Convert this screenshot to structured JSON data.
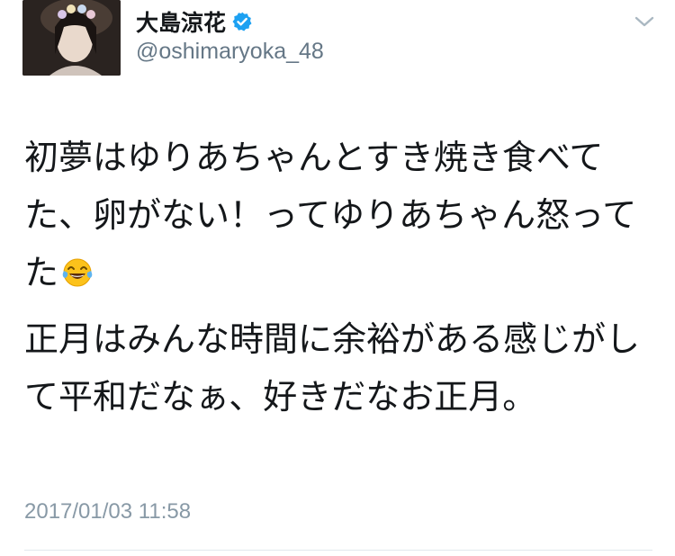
{
  "user": {
    "display_name": "大島涼花",
    "handle": "@oshimaryoka_48",
    "verified": true
  },
  "tweet": {
    "paragraph_1": "初夢はゆりあちゃんとすき焼き食べてた、卵がない！ってゆりあちゃん怒ってた",
    "emoji": "face-with-tears-of-joy-icon",
    "paragraph_2": "正月はみんな時間に余裕がある感じがして平和だなぁ、好きだなお正月。",
    "timestamp": "2017/01/03 11:58"
  },
  "colors": {
    "text": "#14171a",
    "secondary": "#657786",
    "timestamp": "#8899a6",
    "verified_badge": "#1da1f2",
    "divider": "#e1e8ed"
  }
}
